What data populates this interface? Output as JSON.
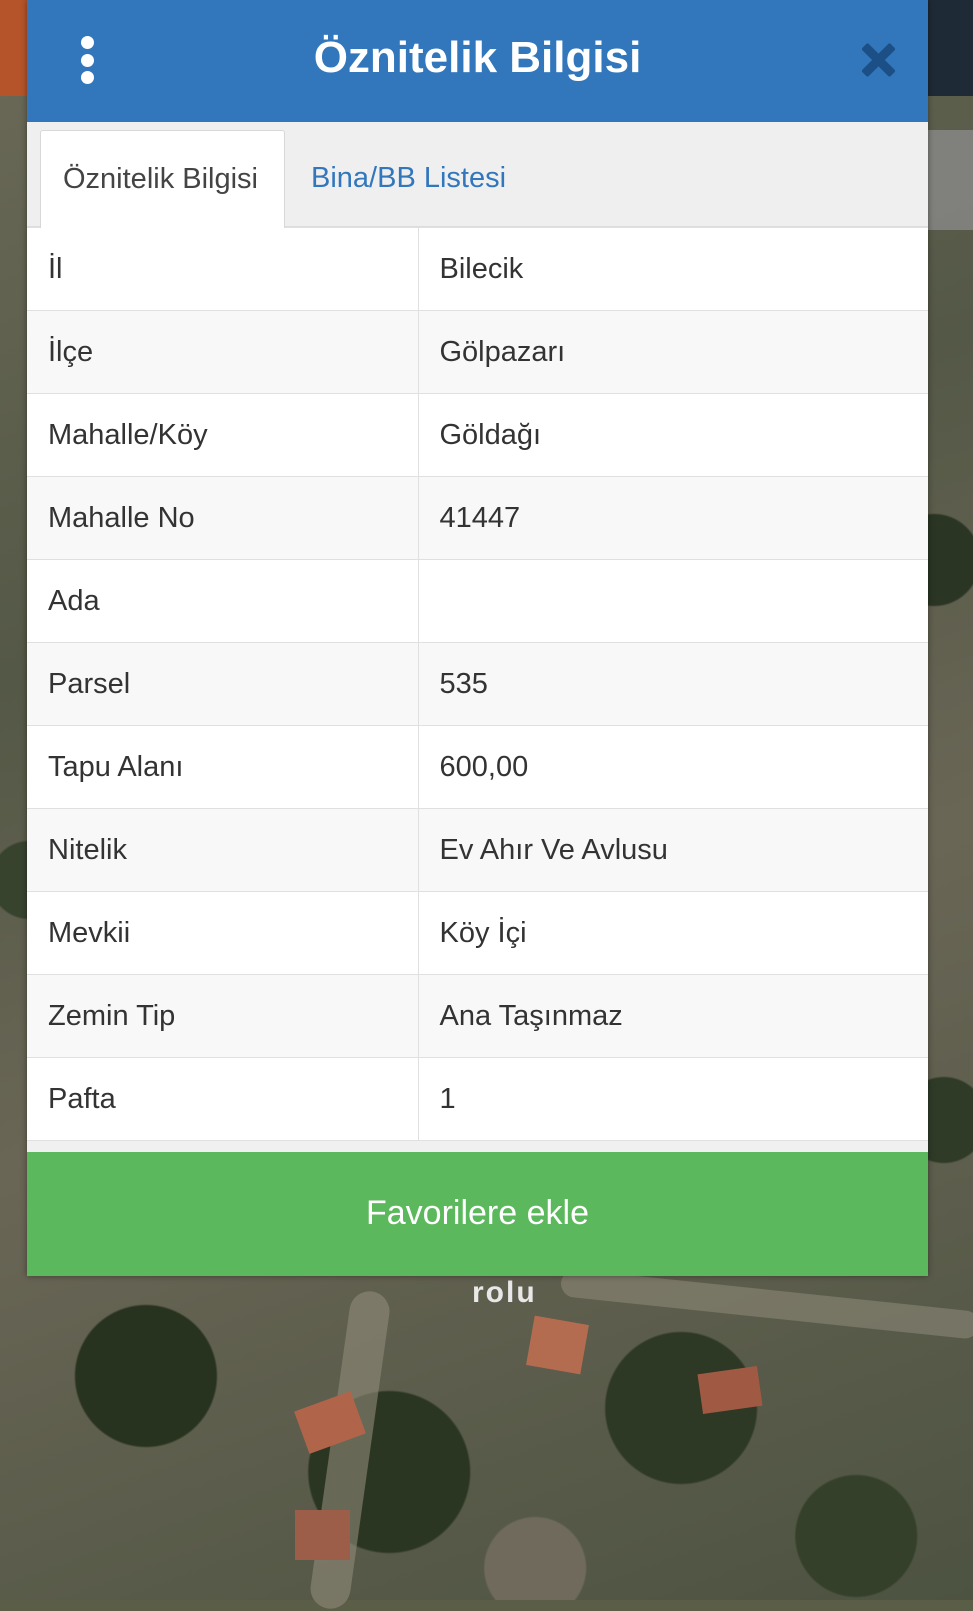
{
  "dialog": {
    "title": "Öznitelik Bilgisi",
    "menu_icon": "vertical-dots-icon",
    "close_icon": "close-icon",
    "accent_color": "#3277bc",
    "button_color": "#5cb85c"
  },
  "tabs": [
    {
      "label": "Öznitelik Bilgisi",
      "active": true
    },
    {
      "label": "Bina/BB Listesi",
      "active": false
    }
  ],
  "attributes": [
    {
      "key": "İl",
      "value": "Bilecik"
    },
    {
      "key": "İlçe",
      "value": "Gölpazarı"
    },
    {
      "key": "Mahalle/Köy",
      "value": "Göldağı"
    },
    {
      "key": "Mahalle No",
      "value": "41447"
    },
    {
      "key": "Ada",
      "value": ""
    },
    {
      "key": "Parsel",
      "value": "535"
    },
    {
      "key": "Tapu Alanı",
      "value": "600,00"
    },
    {
      "key": "Nitelik",
      "value": "Ev Ahır Ve Avlusu"
    },
    {
      "key": "Mevkii",
      "value": "Köy İçi"
    },
    {
      "key": "Zemin Tip",
      "value": "Ana Taşınmaz"
    },
    {
      "key": "Pafta",
      "value": "1"
    }
  ],
  "favorite_button": "Favorilere ekle",
  "map": {
    "label_fragment": "rolu"
  }
}
